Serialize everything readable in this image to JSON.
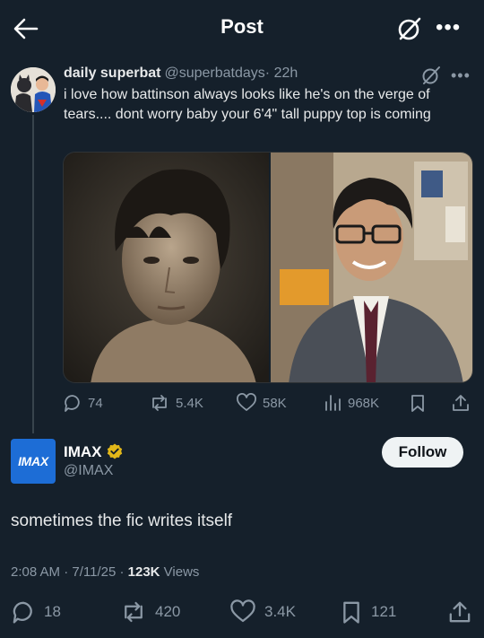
{
  "header": {
    "title": "Post",
    "back_icon": "arrow-left-icon",
    "grok_icon": "grok-icon",
    "more_label": "•••"
  },
  "parent_tweet": {
    "display_name": "daily superbat",
    "handle": "@superbatdays",
    "time": "· 22h",
    "more_label": "•••",
    "text": "i love how battinson always looks like he's on the verge of tears.... dont worry baby your 6'4\" tall puppy top is coming",
    "stats": {
      "replies": "74",
      "reposts": "5.4K",
      "likes": "58K",
      "views": "968K"
    }
  },
  "main_tweet": {
    "display_name": "IMAX",
    "handle": "@IMAX",
    "logo_text": "IMAX",
    "follow_label": "Follow",
    "text": "sometimes the fic writes itself",
    "time": "2:08 AM · 7/11/25 · ",
    "views_count": "123K",
    "views_label": " Views",
    "stats": {
      "replies": "18",
      "reposts": "420",
      "likes": "3.4K",
      "bookmarks": "121"
    }
  },
  "colors": {
    "background": "#15202b",
    "muted": "#8b98a5",
    "verified_gold": "#e2b719",
    "imax_blue": "#1d6dd6"
  }
}
